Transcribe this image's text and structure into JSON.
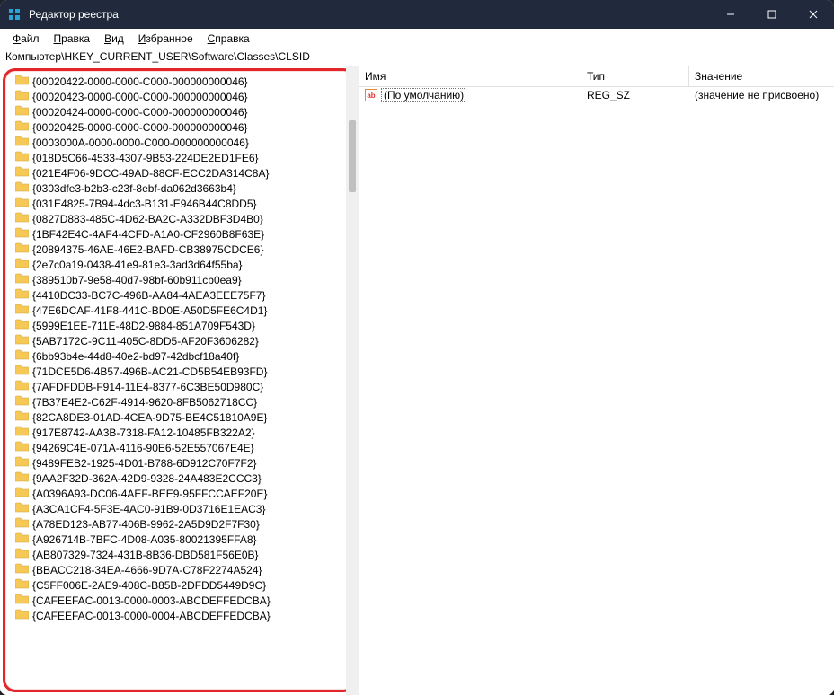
{
  "title": "Редактор реестра",
  "menus": {
    "file": {
      "letter": "Ф",
      "rest": "айл"
    },
    "edit": {
      "letter": "П",
      "rest": "равка"
    },
    "view": {
      "letter": "В",
      "rest": "ид"
    },
    "fav": {
      "letter": "И",
      "rest": "збранное"
    },
    "help": {
      "letter": "С",
      "rest": "правка"
    }
  },
  "address": "Компьютер\\HKEY_CURRENT_USER\\Software\\Classes\\CLSID",
  "tree": [
    "{00020422-0000-0000-C000-000000000046}",
    "{00020423-0000-0000-C000-000000000046}",
    "{00020424-0000-0000-C000-000000000046}",
    "{00020425-0000-0000-C000-000000000046}",
    "{0003000A-0000-0000-C000-000000000046}",
    "{018D5C66-4533-4307-9B53-224DE2ED1FE6}",
    "{021E4F06-9DCC-49AD-88CF-ECC2DA314C8A}",
    "{0303dfe3-b2b3-c23f-8ebf-da062d3663b4}",
    "{031E4825-7B94-4dc3-B131-E946B44C8DD5}",
    "{0827D883-485C-4D62-BA2C-A332DBF3D4B0}",
    "{1BF42E4C-4AF4-4CFD-A1A0-CF2960B8F63E}",
    "{20894375-46AE-46E2-BAFD-CB38975CDCE6}",
    "{2e7c0a19-0438-41e9-81e3-3ad3d64f55ba}",
    "{389510b7-9e58-40d7-98bf-60b911cb0ea9}",
    "{4410DC33-BC7C-496B-AA84-4AEA3EEE75F7}",
    "{47E6DCAF-41F8-441C-BD0E-A50D5FE6C4D1}",
    "{5999E1EE-711E-48D2-9884-851A709F543D}",
    "{5AB7172C-9C11-405C-8DD5-AF20F3606282}",
    "{6bb93b4e-44d8-40e2-bd97-42dbcf18a40f}",
    "{71DCE5D6-4B57-496B-AC21-CD5B54EB93FD}",
    "{7AFDFDDB-F914-11E4-8377-6C3BE50D980C}",
    "{7B37E4E2-C62F-4914-9620-8FB5062718CC}",
    "{82CA8DE3-01AD-4CEA-9D75-BE4C51810A9E}",
    "{917E8742-AA3B-7318-FA12-10485FB322A2}",
    "{94269C4E-071A-4116-90E6-52E557067E4E}",
    "{9489FEB2-1925-4D01-B788-6D912C70F7F2}",
    "{9AA2F32D-362A-42D9-9328-24A483E2CCC3}",
    "{A0396A93-DC06-4AEF-BEE9-95FFCCAEF20E}",
    "{A3CA1CF4-5F3E-4AC0-91B9-0D3716E1EAC3}",
    "{A78ED123-AB77-406B-9962-2A5D9D2F7F30}",
    "{A926714B-7BFC-4D08-A035-80021395FFA8}",
    "{AB807329-7324-431B-8B36-DBD581F56E0B}",
    "{BBACC218-34EA-4666-9D7A-C78F2274A524}",
    "{C5FF006E-2AE9-408C-B85B-2DFDD5449D9C}",
    "{CAFEEFAC-0013-0000-0003-ABCDEFFEDCBA}",
    "{CAFEEFAC-0013-0000-0004-ABCDEFFEDCBA}"
  ],
  "columns": {
    "name": "Имя",
    "type": "Тип",
    "data": "Значение"
  },
  "value": {
    "name": "(По умолчанию)",
    "type": "REG_SZ",
    "data": "(значение не присвоено)"
  }
}
